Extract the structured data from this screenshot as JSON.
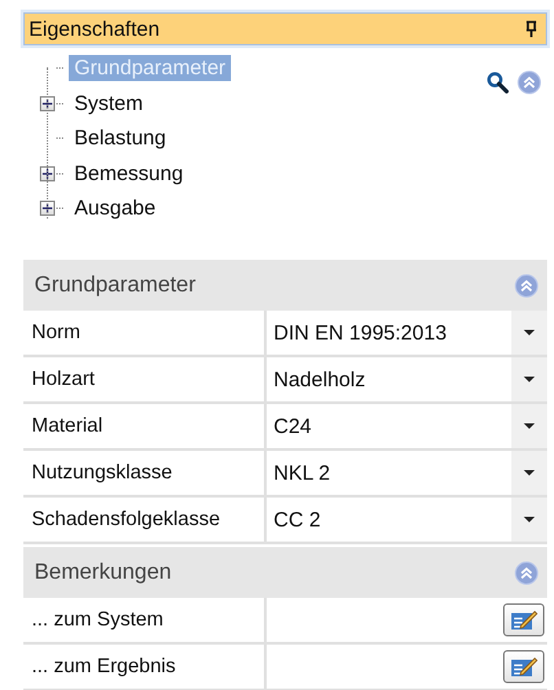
{
  "panel": {
    "title": "Eigenschaften"
  },
  "tree": [
    {
      "label": "Grundparameter",
      "kind": "leaf",
      "selected": true
    },
    {
      "label": "System",
      "kind": "node",
      "selected": false
    },
    {
      "label": "Belastung",
      "kind": "leaf",
      "selected": false
    },
    {
      "label": "Bemessung",
      "kind": "node",
      "selected": false
    },
    {
      "label": "Ausgabe",
      "kind": "node",
      "selected": false
    }
  ],
  "sections": [
    {
      "title": "Grundparameter",
      "rows": [
        {
          "label": "Norm",
          "value": "DIN EN 1995:2013",
          "kind": "dropdown"
        },
        {
          "label": "Holzart",
          "value": "Nadelholz",
          "kind": "dropdown"
        },
        {
          "label": "Material",
          "value": "C24",
          "kind": "dropdown"
        },
        {
          "label": "Nutzungsklasse",
          "value": "NKL 2",
          "kind": "dropdown"
        },
        {
          "label": "Schadensfolgeklasse",
          "value": "CC 2",
          "kind": "dropdown"
        }
      ]
    },
    {
      "title": "Bemerkungen",
      "rows": [
        {
          "label": "... zum System",
          "kind": "edit"
        },
        {
          "label": "... zum Ergebnis",
          "kind": "edit"
        }
      ]
    }
  ]
}
